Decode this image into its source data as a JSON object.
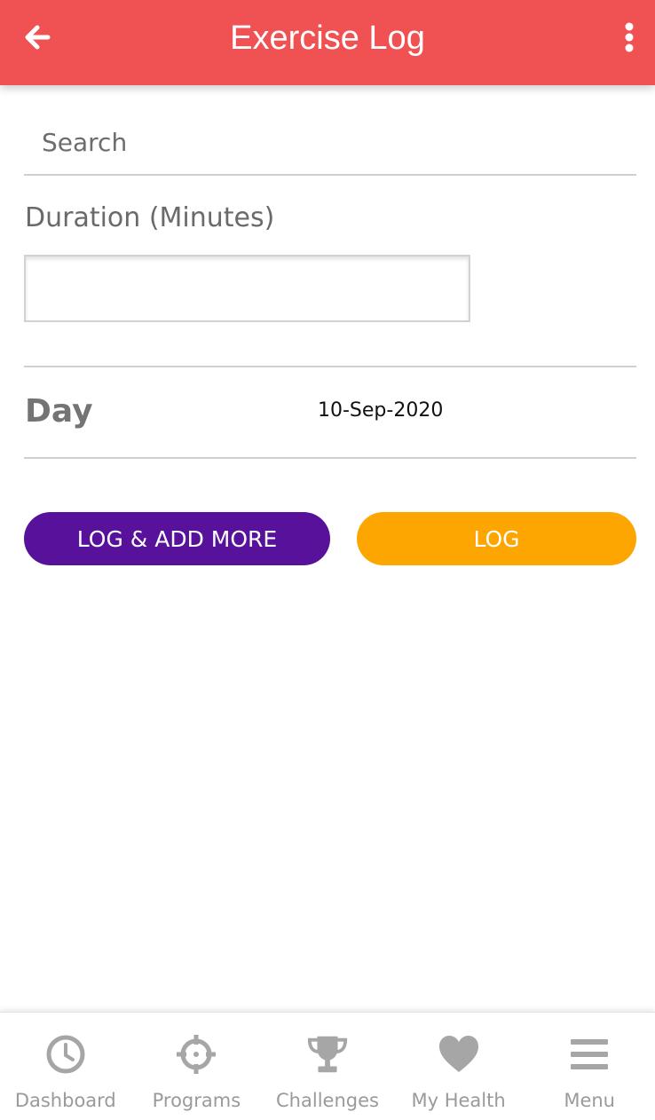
{
  "header": {
    "title": "Exercise Log",
    "back_icon": "arrow-left-icon",
    "more_icon": "more-vertical-icon",
    "background_color": "#f05152"
  },
  "search": {
    "placeholder": "Search",
    "value": ""
  },
  "duration": {
    "label": "Duration (Minutes)",
    "value": ""
  },
  "day": {
    "label": "Day",
    "value": "10-Sep-2020"
  },
  "actions": {
    "log_add_more_label": "LOG & ADD MORE",
    "log_label": "LOG",
    "log_add_more_color": "#58119a",
    "log_color": "#fda500"
  },
  "bottom_nav": {
    "items": [
      {
        "label": "Dashboard",
        "icon": "clock-icon"
      },
      {
        "label": "Programs",
        "icon": "crosshair-icon"
      },
      {
        "label": "Challenges",
        "icon": "trophy-icon"
      },
      {
        "label": "My Health",
        "icon": "heart-icon"
      },
      {
        "label": "Menu",
        "icon": "menu-icon"
      }
    ],
    "icon_color": "#a6a6a6"
  }
}
